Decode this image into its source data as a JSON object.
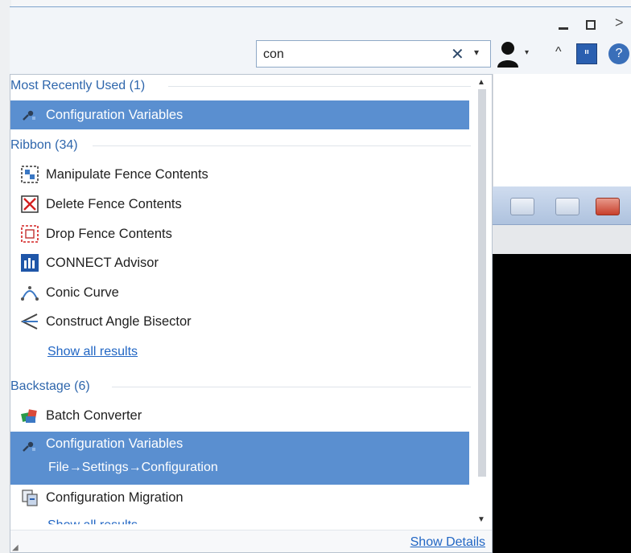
{
  "search": {
    "value": "con",
    "clear_glyph": "✕",
    "dropdown_glyph": "▾"
  },
  "window": {
    "minimize_icon": "minimize-icon",
    "maximize_icon": "maximize-icon",
    "close_glyph": ">"
  },
  "toolbar": {
    "user_icon": "user-icon",
    "user_dropdown_glyph": "▾",
    "collapse_glyph": "^",
    "connect_glyph": "ᑊᑊ",
    "help_glyph": "?"
  },
  "sections": {
    "recent": {
      "header": "Most Recently Used (1)",
      "items": [
        {
          "label": "Configuration Variables",
          "icon": "config-variables-icon",
          "selected": true
        }
      ]
    },
    "ribbon": {
      "header": "Ribbon (34)",
      "items": [
        {
          "label": "Manipulate Fence Contents",
          "icon": "manipulate-fence-icon"
        },
        {
          "label": "Delete Fence Contents",
          "icon": "delete-fence-icon"
        },
        {
          "label": "Drop Fence Contents",
          "icon": "drop-fence-icon"
        },
        {
          "label": "CONNECT Advisor",
          "icon": "connect-advisor-icon"
        },
        {
          "label": "Conic Curve",
          "icon": "conic-curve-icon"
        },
        {
          "label": "Construct Angle Bisector",
          "icon": "angle-bisector-icon"
        }
      ],
      "show_all": "Show all results"
    },
    "backstage": {
      "header": "Backstage (6)",
      "items": [
        {
          "label": "Batch Converter",
          "icon": "batch-converter-icon"
        },
        {
          "label": "Configuration Variables",
          "path": "File→Settings→Configuration",
          "icon": "config-variables-icon",
          "selected": true
        },
        {
          "label": "Configuration Migration",
          "icon": "config-migration-icon"
        }
      ],
      "show_all": "Show all results"
    }
  },
  "footer": {
    "show_details": "Show Details"
  },
  "colors": {
    "selection": "#5a8fd0",
    "section_header": "#2e66ac",
    "link": "#2166c4",
    "viewport": "#000000"
  }
}
